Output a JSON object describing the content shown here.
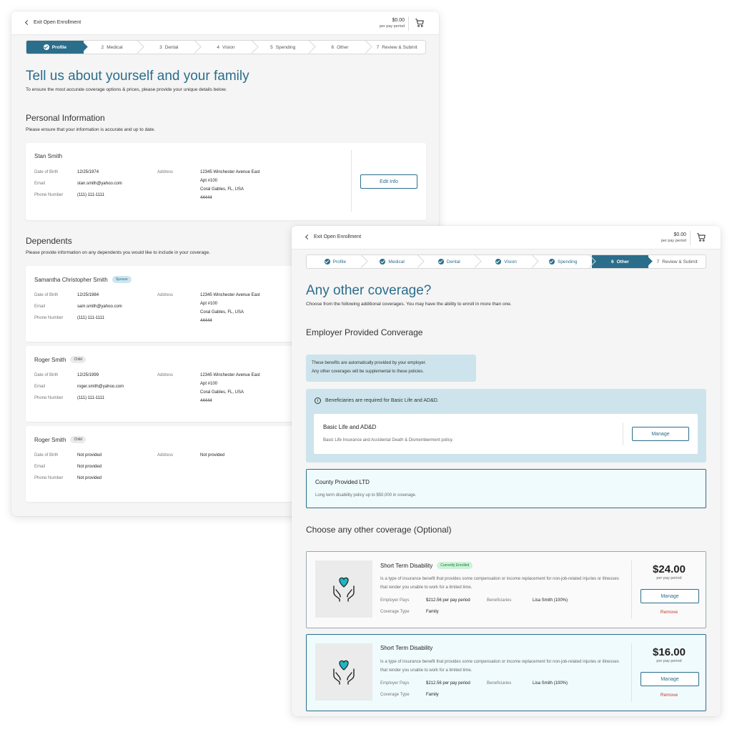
{
  "back": {
    "exit_label": "Exit Open Enrollment",
    "cart_price": "$0.00",
    "cart_period": "per pay period",
    "steps": [
      {
        "num": "",
        "label": "Profile"
      },
      {
        "num": "2",
        "label": "Medical"
      },
      {
        "num": "3",
        "label": "Dental"
      },
      {
        "num": "4",
        "label": "Vision"
      },
      {
        "num": "5",
        "label": "Spending"
      },
      {
        "num": "6",
        "label": "Other"
      },
      {
        "num": "7",
        "label": "Review & Submit"
      }
    ],
    "title": "Tell us about yourself and your family",
    "subtitle": "To ensure the most accurate coverage options & prices, please provide your unique details below.",
    "personal_heading": "Personal Information",
    "personal_sub": "Please ensure that your information is accurate and up to date.",
    "labels": {
      "dob": "Date of Birth",
      "email": "Email",
      "phone": "Phone Number",
      "address": "Address"
    },
    "primary": {
      "name": "Stan Smith",
      "dob": "12/25/1974",
      "email": "stan.smith@yahoo.com",
      "phone": "(111) 111-1111",
      "address": [
        "12345 Winchester Avenue East",
        "Apt #100",
        "Coral Gables, FL, USA",
        "44444"
      ],
      "edit_label": "Edit Info"
    },
    "dependents_heading": "Dependents",
    "dependents_sub": "Please provide information on any dependents you would like to include in your coverage.",
    "dependents": [
      {
        "name": "Samantha Christopher Smith",
        "tag": "Spouse",
        "dob": "12/25/1984",
        "email": "sam.smith@yahoo.com",
        "phone": "(111) 111-1111",
        "address": [
          "12345 Winchester Avenue East",
          "Apt #100",
          "Coral Gables, FL, USA",
          "44444"
        ]
      },
      {
        "name": "Roger Smith",
        "tag": "Child",
        "dob": "12/25/1999",
        "email": "roger.smith@yahoo.com",
        "phone": "(111) 111-1111",
        "address": [
          "12345 Winchester Avenue East",
          "Apt #100",
          "Coral Gables, FL, USA",
          "44444"
        ]
      },
      {
        "name": "Roger Smith",
        "tag": "Child",
        "dob": "Not provided",
        "email": "Not provided",
        "phone": "Not provided",
        "address": [
          "Not provided",
          "",
          "",
          ""
        ]
      }
    ]
  },
  "front": {
    "exit_label": "Exit Open Enrollment",
    "cart_price": "$0.00",
    "cart_period": "per pay period",
    "steps": [
      {
        "num": "",
        "label": "Profile"
      },
      {
        "num": "",
        "label": "Medical"
      },
      {
        "num": "",
        "label": "Dental"
      },
      {
        "num": "",
        "label": "Vision"
      },
      {
        "num": "",
        "label": "Spending"
      },
      {
        "num": "6",
        "label": "Other"
      },
      {
        "num": "7",
        "label": "Review & Submit"
      }
    ],
    "title": "Any other coverage?",
    "subtitle": "Choose from the following additional coverages. You may have the ability to enroll in more than one.",
    "employer_heading": "Employer Provided Converage",
    "employer_info_1": "These benefits are automatically provided by your employer.",
    "employer_info_2": "Any other coverages will be supplemental to these policies.",
    "beneficiary_note": "Beneficiaries are required for Basic Life and AD&D.",
    "basic_life": {
      "title": "Basic Life and AD&D",
      "desc": "Basic Life Insurance and Accidental Death & Dismemberment policy.",
      "manage": "Manage"
    },
    "ltd": {
      "title": "County Provided LTD",
      "desc": "Long term disability policy up to $50,000 in coverage."
    },
    "optional_heading": "Choose any other coverage (Optional)",
    "coverages": [
      {
        "title": "Short Term Disability",
        "badge": "Currently Enrolled",
        "desc": "Is a type of insurance benefit that provides some compensation or income replacement for non-job-related injuries or illnesses that render you unable to work for a limited time.",
        "employer_pays_label": "Employer Pays",
        "employer_pays": "$212.56 per pay period",
        "beneficiaries_label": "Beneficiaries",
        "beneficiaries": "Lisa Smith (100%)",
        "coverage_type_label": "Coverage Type",
        "coverage_type": "Family",
        "price": "$24.00",
        "period": "per pay period",
        "manage": "Manage",
        "remove": "Remove"
      },
      {
        "title": "Short Term Disability",
        "badge": "",
        "desc": "Is a type of insurance benefit that provides some compensation or income replacement for non-job-related injuries or illnesses that render you unable to work for a limited time.",
        "employer_pays_label": "Employer Pays",
        "employer_pays": "$212.56 per pay period",
        "beneficiaries_label": "Beneficiaries",
        "beneficiaries": "Lisa Smith (100%)",
        "coverage_type_label": "Coverage Type",
        "coverage_type": "Family",
        "price": "$16.00",
        "period": "per pay period",
        "manage": "Manage",
        "remove": "Remove"
      }
    ]
  },
  "colors": {
    "primary": "#2b6e8c",
    "accent_teal": "#1fb6c1",
    "remove": "#c0392b"
  }
}
